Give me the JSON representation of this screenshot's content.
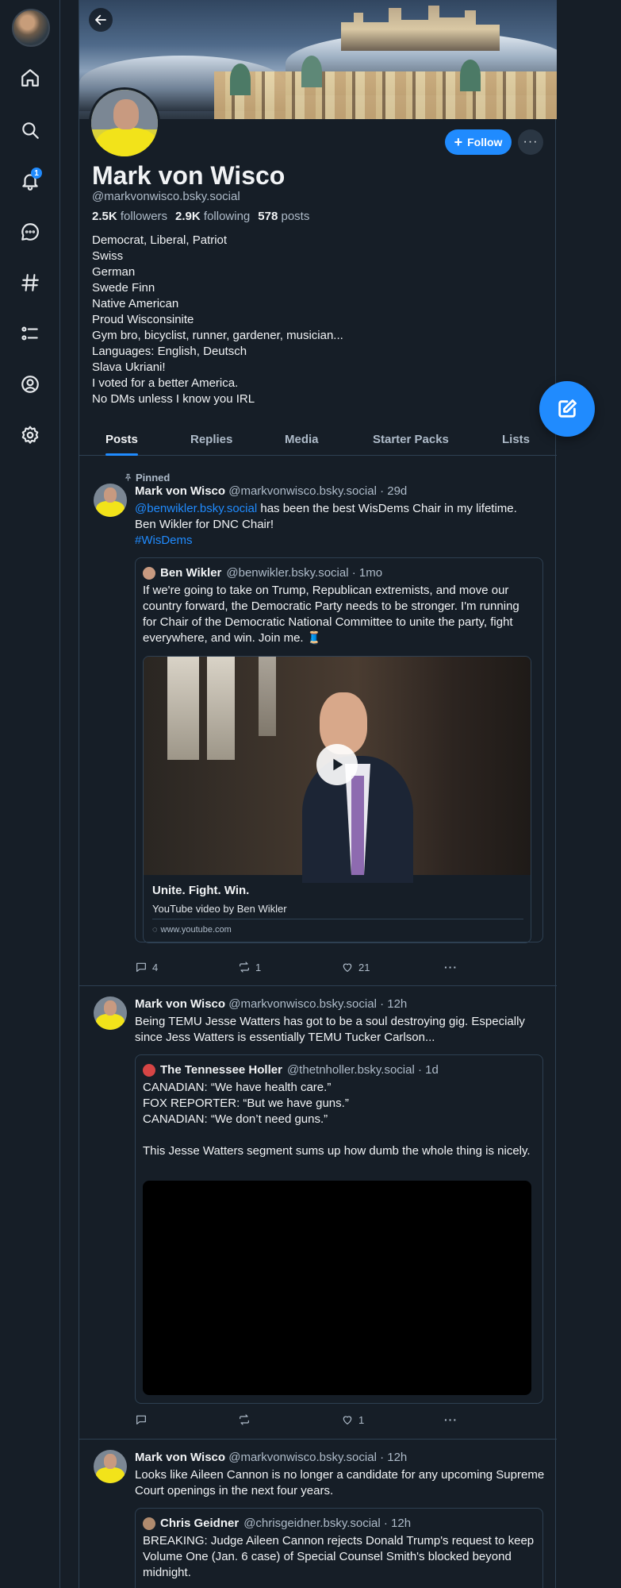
{
  "nav": {
    "notification_count": "1"
  },
  "profile": {
    "display_name": "Mark von Wisco",
    "handle": "@markvonwisco.bsky.social",
    "followers_count": "2.5K",
    "followers_label": "followers",
    "following_count": "2.9K",
    "following_label": "following",
    "posts_count": "578",
    "posts_label": "posts",
    "follow_label": "Follow",
    "bio": [
      "Democrat, Liberal, Patriot",
      "Swiss",
      "German",
      "Swede Finn",
      "Native American",
      "Proud Wisconsinite",
      "Gym bro, bicyclist, runner, gardener, musician...",
      "Languages: English, Deutsch",
      "Slava Ukriani!",
      "I voted for a better America.",
      "No DMs unless I know you IRL"
    ]
  },
  "tabs": [
    "Posts",
    "Replies",
    "Media",
    "Starter Packs",
    "Lists"
  ],
  "posts": [
    {
      "pinned_label": "Pinned",
      "author": "Mark von Wisco",
      "handle_time": "@markvonwisco.bsky.social · 29d",
      "mention": "@benwikler.bsky.social",
      "text_after_mention": " has been the best WisDems Chair in my lifetime.",
      "line2": "Ben Wikler for DNC Chair!",
      "hashtag": "#WisDems",
      "quote": {
        "author": "Ben Wikler",
        "handle_time": "@benwikler.bsky.social · 1mo",
        "text": "If we're going to take on Trump, Republican extremists, and move our country forward, the Democratic Party needs to be stronger. I'm running for Chair of the Democratic National Committee to unite the party, fight everywhere, and win. Join me. 🧵",
        "embed_title": "Unite. Fight. Win.",
        "embed_desc": "YouTube video by Ben Wikler",
        "embed_domain": "www.youtube.com"
      },
      "replies": "4",
      "reposts": "1",
      "likes": "21"
    },
    {
      "author": "Mark von Wisco",
      "handle_time": "@markvonwisco.bsky.social · 12h",
      "text": "Being TEMU Jesse Watters has got to be a soul destroying gig. Especially since Jess Watters is essentially TEMU Tucker Carlson...",
      "quote": {
        "author": "The Tennessee Holler",
        "handle_time": "@thetnholler.bsky.social · 1d",
        "line1": "CANADIAN: “We have health care.”",
        "line2": "FOX REPORTER: “But we have guns.”",
        "line3": "CANADIAN: “We don’t need guns.”",
        "line4": "This Jesse Watters segment sums up how dumb the whole thing is nicely."
      },
      "replies": "",
      "reposts": "",
      "likes": "1"
    },
    {
      "author": "Mark von Wisco",
      "handle_time": "@markvonwisco.bsky.social · 12h",
      "text": "Looks like Aileen Cannon is no longer a candidate for any upcoming Supreme Court openings in the next four years.",
      "quote": {
        "author": "Chris Geidner",
        "handle_time": "@chrisgeidner.bsky.social · 12h",
        "text": "BREAKING: Judge Aileen Cannon rejects Donald Trump's request to keep Volume One (Jan. 6 case) of Special Counsel Smith's blocked beyond midnight."
      }
    }
  ],
  "colors": {
    "accent": "#208bfe",
    "background": "#161e27",
    "border": "#2e4052",
    "muted_text": "#aebbc9"
  },
  "icons": [
    "home-icon",
    "search-icon",
    "bell-icon",
    "chat-icon",
    "hashtag-icon",
    "list-icon",
    "profile-icon",
    "gear-icon",
    "compose-icon"
  ]
}
